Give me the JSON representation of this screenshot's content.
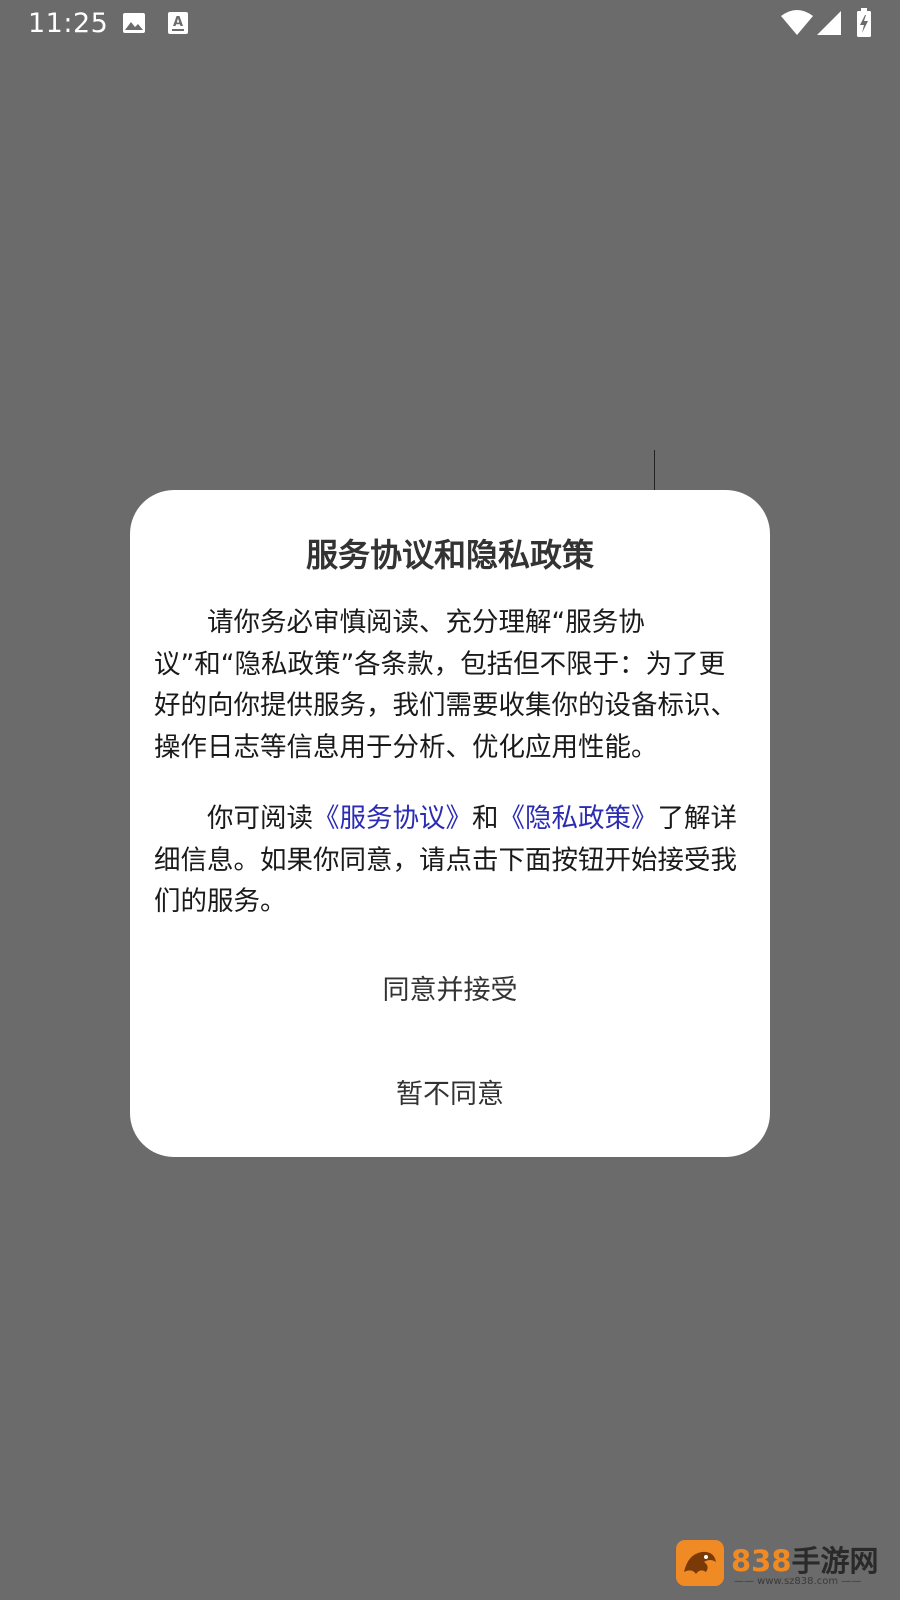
{
  "status_bar": {
    "time": "11:25",
    "icons": [
      "image-icon",
      "font-download-icon",
      "wifi-icon",
      "signal-icon",
      "battery-charging-icon"
    ]
  },
  "dialog": {
    "title": "服务协议和隐私政策",
    "paragraph1": "请你务必审慎阅读、充分理解“服务协议”和“隐私政策”各条款，包括但不限于：为了更好的向你提供服务，我们需要收集你的设备标识、操作日志等信息用于分析、优化应用性能。",
    "paragraph2_prefix": "你可阅读",
    "link_service": "《服务协议》",
    "paragraph2_and": "和",
    "link_privacy": "《隐私政策》",
    "paragraph2_suffix": "了解详细信息。如果你同意，请点击下面按钮开始接受我们的服务。",
    "agree_button": "同意并接受",
    "decline_button": "暂不同意"
  },
  "colors": {
    "overlay": "#6b6b6b",
    "dialog_bg": "#ffffff",
    "link": "#2b2bb3",
    "watermark_orange": "#f08a24"
  },
  "watermark": {
    "brand_number": "838",
    "brand_cn": "手游网",
    "url": "—— www.sz838.com ——"
  }
}
